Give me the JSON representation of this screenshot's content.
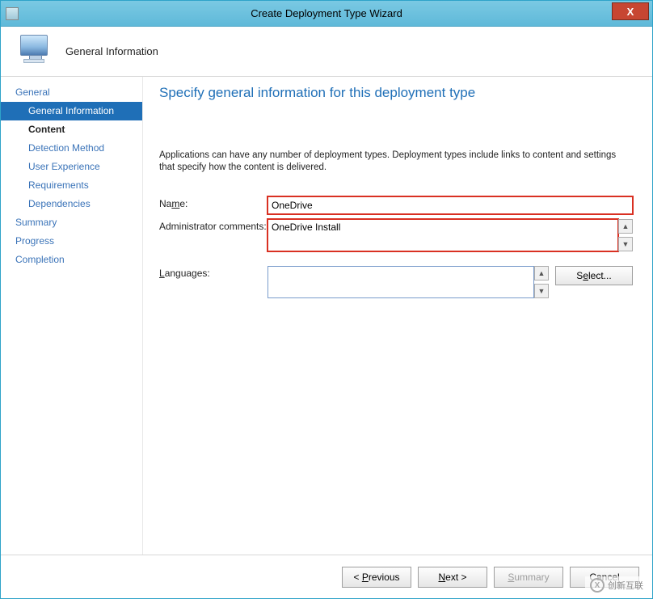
{
  "window": {
    "title": "Create Deployment Type Wizard",
    "close_symbol": "X"
  },
  "header": {
    "title": "General Information"
  },
  "sidebar": {
    "items": [
      {
        "label": "General",
        "type": "top"
      },
      {
        "label": "General Information",
        "type": "sub",
        "active": true
      },
      {
        "label": "Content",
        "type": "sub",
        "bold": true
      },
      {
        "label": "Detection Method",
        "type": "sub"
      },
      {
        "label": "User Experience",
        "type": "sub"
      },
      {
        "label": "Requirements",
        "type": "sub"
      },
      {
        "label": "Dependencies",
        "type": "sub"
      },
      {
        "label": "Summary",
        "type": "top"
      },
      {
        "label": "Progress",
        "type": "top"
      },
      {
        "label": "Completion",
        "type": "top"
      }
    ]
  },
  "main": {
    "heading": "Specify general information for this deployment type",
    "description": "Applications can have any number of deployment types. Deployment types include links to content and settings that specify how the content is delivered.",
    "fields": {
      "name_label": "Name:",
      "name_value": "OneDrive",
      "comments_label": "Administrator comments:",
      "comments_value": "OneDrive Install",
      "languages_label": "Languages:",
      "languages_value": "",
      "select_button": "Select..."
    }
  },
  "footer": {
    "previous": "< Previous",
    "next": "Next >",
    "summary": "Summary",
    "cancel": "Cancel"
  },
  "watermark": {
    "text": "创新互联"
  }
}
